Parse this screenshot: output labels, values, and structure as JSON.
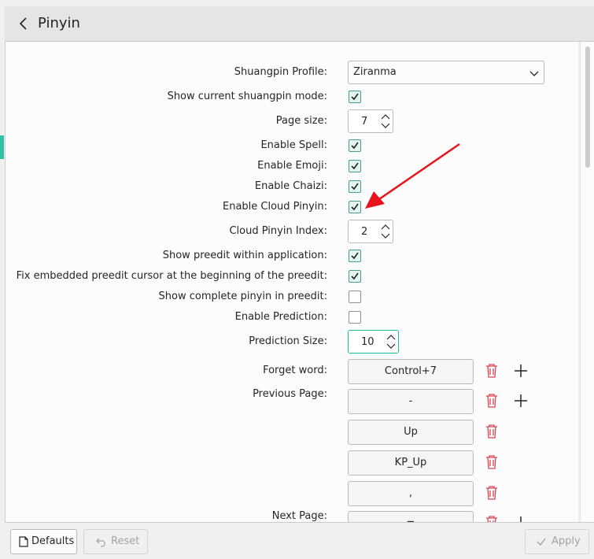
{
  "header": {
    "title": "Pinyin"
  },
  "settings": {
    "shuangpin_profile": {
      "label": "Shuangpin Profile:",
      "value": "Ziranma"
    },
    "show_shuangpin_mode": {
      "label": "Show current shuangpin mode:",
      "checked": true
    },
    "page_size": {
      "label": "Page size:",
      "value": "7"
    },
    "enable_spell": {
      "label": "Enable Spell:",
      "checked": true
    },
    "enable_emoji": {
      "label": "Enable Emoji:",
      "checked": true
    },
    "enable_chaizi": {
      "label": "Enable Chaizi:",
      "checked": true
    },
    "enable_cloud_pinyin": {
      "label": "Enable Cloud Pinyin:",
      "checked": true
    },
    "cloud_pinyin_index": {
      "label": "Cloud Pinyin Index:",
      "value": "2"
    },
    "show_preedit": {
      "label": "Show preedit within application:",
      "checked": true
    },
    "fix_preedit_cursor": {
      "label": "Fix embedded preedit cursor at the beginning of the preedit:",
      "checked": true
    },
    "show_complete_pinyin": {
      "label": "Show complete pinyin in preedit:",
      "checked": false
    },
    "enable_prediction": {
      "label": "Enable Prediction:",
      "checked": false
    },
    "prediction_size": {
      "label": "Prediction Size:",
      "value": "10"
    },
    "forget_word": {
      "label": "Forget word:",
      "keys": [
        "Control+7"
      ]
    },
    "previous_page": {
      "label": "Previous Page:",
      "keys": [
        "-",
        "Up",
        "KP_Up",
        ","
      ]
    },
    "next_page": {
      "label": "Next Page:",
      "keys": [
        "="
      ]
    }
  },
  "footer": {
    "defaults": "Defaults",
    "reset": "Reset",
    "apply": "Apply"
  },
  "colors": {
    "accent": "#1abc9c",
    "annotation_arrow": "#e8141b",
    "delete": "#da4453"
  }
}
